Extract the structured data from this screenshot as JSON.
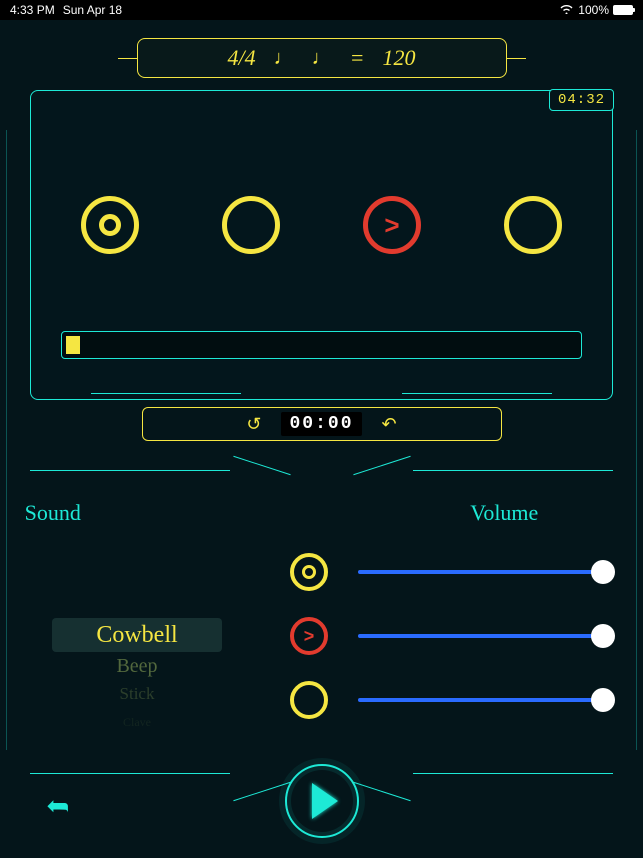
{
  "status": {
    "time": "4:33 PM",
    "date": "Sun Apr 18",
    "battery_pct": "100%"
  },
  "tempo": {
    "time_signature": "4/4",
    "note1_glyph": "♩",
    "note2_glyph": "♩",
    "equals": "=",
    "bpm": "120"
  },
  "session_time": "04:32",
  "beats": [
    {
      "type": "downbeat",
      "color": "yellow"
    },
    {
      "type": "beat",
      "color": "yellow"
    },
    {
      "type": "accent",
      "color": "red"
    },
    {
      "type": "beat",
      "color": "yellow"
    }
  ],
  "timer": {
    "display": "00:00",
    "reset_icon": "↺",
    "undo_icon": "↶"
  },
  "labels": {
    "sound": "Sound",
    "volume": "Volume"
  },
  "sound_picker": {
    "selected": "Cowbell",
    "others": [
      "Beep",
      "Stick",
      "Clave"
    ]
  },
  "volume_rows": [
    {
      "icon": "downbeat",
      "value": 100
    },
    {
      "icon": "accent",
      "value": 100
    },
    {
      "icon": "beat",
      "value": 100
    }
  ],
  "colors": {
    "cyan": "#1de9d6",
    "yellow": "#f5e642",
    "red": "#e23b2e",
    "blue": "#2a6bff"
  }
}
